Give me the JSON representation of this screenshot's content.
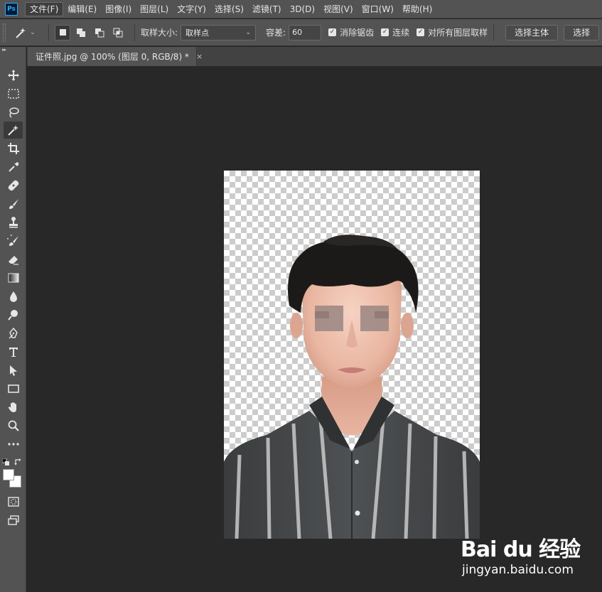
{
  "app": {
    "logo": "Ps"
  },
  "menu": [
    "文件(F)",
    "编辑(E)",
    "图像(I)",
    "图层(L)",
    "文字(Y)",
    "选择(S)",
    "滤镜(T)",
    "3D(D)",
    "视图(V)",
    "窗口(W)",
    "帮助(H)"
  ],
  "options": {
    "sample_size_label": "取样大小:",
    "sample_size_value": "取样点",
    "tolerance_label": "容差:",
    "tolerance_value": "60",
    "antialias_label": "消除锯齿",
    "contiguous_label": "连续",
    "sample_all_layers_label": "对所有图层取样",
    "select_subject_label": "选择主体",
    "select_mask_label": "选择"
  },
  "document": {
    "tab_title": "证件照.jpg @ 100% (图层 0, RGB/8) *",
    "close_glyph": "×"
  },
  "tools": [
    "move-icon",
    "marquee-icon",
    "lasso-icon",
    "magic-wand-icon",
    "crop-icon",
    "eyedropper-icon",
    "healing-brush-icon",
    "brush-icon",
    "clone-stamp-icon",
    "history-brush-icon",
    "eraser-icon",
    "gradient-icon",
    "blur-icon",
    "dodge-icon",
    "pen-icon",
    "type-icon",
    "path-select-icon",
    "rectangle-icon",
    "hand-icon",
    "zoom-icon",
    "more-tools-icon"
  ],
  "colors": {
    "foreground": "#ffffff",
    "background": "#ffffff",
    "ui_panel": "#535353",
    "canvas_bg": "#282828"
  },
  "watermark": {
    "brand": "Bai du 经验",
    "site": "jingyan.baidu.com"
  }
}
